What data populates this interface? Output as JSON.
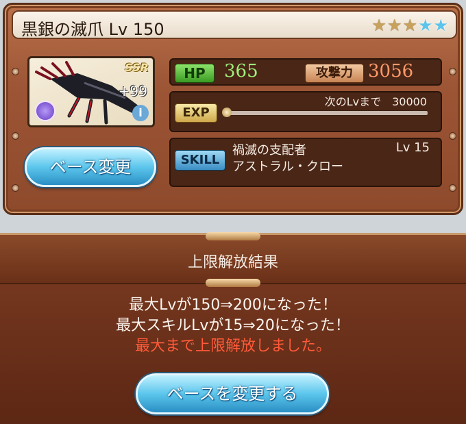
{
  "weapon": {
    "title": "黒銀の滅爪 Lv 150",
    "rarity": "SSR",
    "plus": "+99",
    "stars": [
      "gold",
      "gold",
      "gold",
      "blue",
      "blue"
    ],
    "star_glyph": "★"
  },
  "stats": {
    "hp_label": "HP",
    "hp_value": "365",
    "atk_label": "攻撃力",
    "atk_value": "3056",
    "exp_label": "EXP",
    "exp_next": "次のLvまで　30000",
    "exp_progress": 0.0
  },
  "skill": {
    "label": "SKILL",
    "name": "禍滅の支配者",
    "level": "Lv 15",
    "description": "アストラル・クロー"
  },
  "buttons": {
    "base_change": "ベース変更",
    "change_base": "ベースを変更する"
  },
  "result": {
    "title": "上限解放結果",
    "line1": "最大Lvが150⇒200になった！",
    "line2": "最大スキルLvが15⇒20になった！",
    "line3": "最大まで上限解放しました。"
  },
  "icons": {
    "element": "dark-element-icon",
    "info": "info-icon",
    "info_glyph": "i"
  },
  "colors": {
    "hp_text": "#9ef07a",
    "atk_text": "#ff9a6a",
    "warning_text": "#ff5a3a"
  }
}
